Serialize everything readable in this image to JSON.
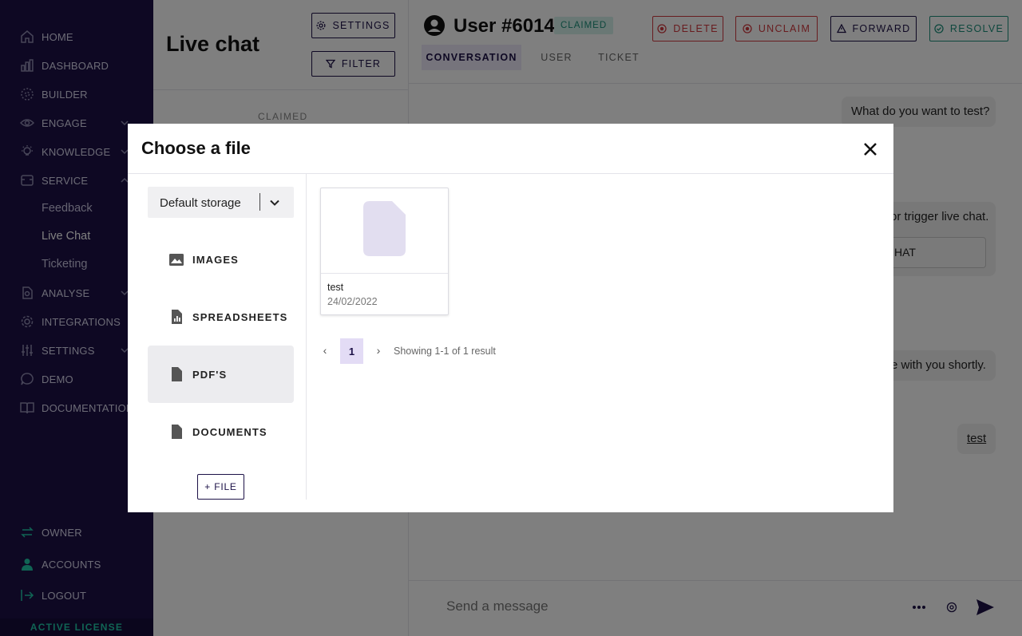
{
  "sidebar": {
    "items": [
      {
        "label": "HOME",
        "icon": "home-icon"
      },
      {
        "label": "DASHBOARD",
        "icon": "chart-icon"
      },
      {
        "label": "BUILDER",
        "icon": "builder-icon"
      },
      {
        "label": "ENGAGE",
        "icon": "eye-icon"
      },
      {
        "label": "KNOWLEDGE",
        "icon": "lightbulb-icon"
      },
      {
        "label": "SERVICE",
        "icon": "service-icon"
      },
      {
        "label": "ANALYSE",
        "icon": "analyse-icon"
      },
      {
        "label": "INTEGRATIONS",
        "icon": "integrations-icon"
      },
      {
        "label": "SETTINGS",
        "icon": "sliders-icon"
      },
      {
        "label": "DEMO",
        "icon": "chat-bubble-icon"
      },
      {
        "label": "DOCUMENTATION",
        "icon": "book-icon"
      }
    ],
    "service_subitems": [
      "Feedback",
      "Live Chat",
      "Ticketing"
    ],
    "bottom": [
      {
        "label": "OWNER",
        "icon": "swap-icon"
      },
      {
        "label": "ACCOUNTS",
        "icon": "user-icon"
      },
      {
        "label": "LOGOUT",
        "icon": "logout-icon"
      }
    ],
    "license": "ACTIVE LICENSE"
  },
  "livechat": {
    "title": "Live chat",
    "settings_label": "SETTINGS",
    "filter_label": "FILTER",
    "section_label": "CLAIMED"
  },
  "conversation": {
    "user_name": "User #6014",
    "status_badge": "CLAIMED",
    "actions": {
      "delete": "DELETE",
      "unclaim": "UNCLAIM",
      "forward": "FORWARD",
      "resolve": "RESOLVE"
    },
    "tabs": [
      "CONVERSATION",
      "USER",
      "TICKET"
    ],
    "messages": [
      "What do you want to test?",
      "or trigger live chat.",
      "HAT",
      "e with you shortly.",
      "test"
    ],
    "composer_placeholder": "Send a message"
  },
  "modal": {
    "title": "Choose a file",
    "storage_value": "Default storage",
    "categories": [
      "IMAGES",
      "SPREADSHEETS",
      "PDF'S",
      "DOCUMENTS"
    ],
    "add_file_label": "+ FILE",
    "files": [
      {
        "name": "test",
        "date": "24/02/2022"
      }
    ],
    "pagination": {
      "current_page": "1",
      "info": "Showing 1-1 of 1 result"
    }
  },
  "colors": {
    "sidebar_bg": "#1c1147",
    "accent": "#1c1147",
    "danger": "#d0393e",
    "teal": "#1a8f7a",
    "license": "#20c8a8"
  }
}
